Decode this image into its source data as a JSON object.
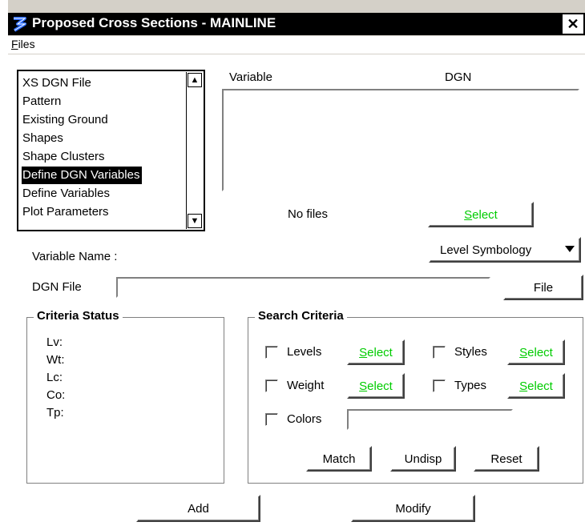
{
  "window": {
    "title": "Proposed Cross Sections - MAINLINE",
    "close_glyph": "✕"
  },
  "menu": {
    "files": {
      "underlined": "F",
      "rest": "iles"
    }
  },
  "category_list": {
    "items": [
      "XS DGN File",
      "Pattern",
      "Existing Ground",
      "Shapes",
      "Shape Clusters",
      "Define DGN Variables",
      "Define Variables",
      "Plot Parameters"
    ],
    "selected": "Define DGN Variables"
  },
  "variables_table": {
    "col_variable": "Variable",
    "col_dgn": "DGN",
    "status": "No files"
  },
  "select_button": {
    "underlined": "S",
    "rest": "elect"
  },
  "variable_name_label": "Variable Name :",
  "level_symbology": {
    "value": "Level Symbology"
  },
  "dgn_file": {
    "label": "DGN File",
    "value": "",
    "button": "File"
  },
  "criteria_status": {
    "title": "Criteria Status",
    "lines": [
      "Lv:",
      "Wt:",
      "Lc:",
      "Co:",
      "Tp:"
    ]
  },
  "search_criteria": {
    "title": "Search Criteria",
    "levels": "Levels",
    "styles": "Styles",
    "weight": "Weight",
    "types": "Types",
    "colors": "Colors",
    "colors_value": "",
    "match": "Match",
    "undisp": "Undisp",
    "reset": "Reset"
  },
  "add_button": "Add",
  "modify_button": "Modify",
  "colors": {
    "accent_green": "#00cc00",
    "title_bg": "#000000"
  }
}
